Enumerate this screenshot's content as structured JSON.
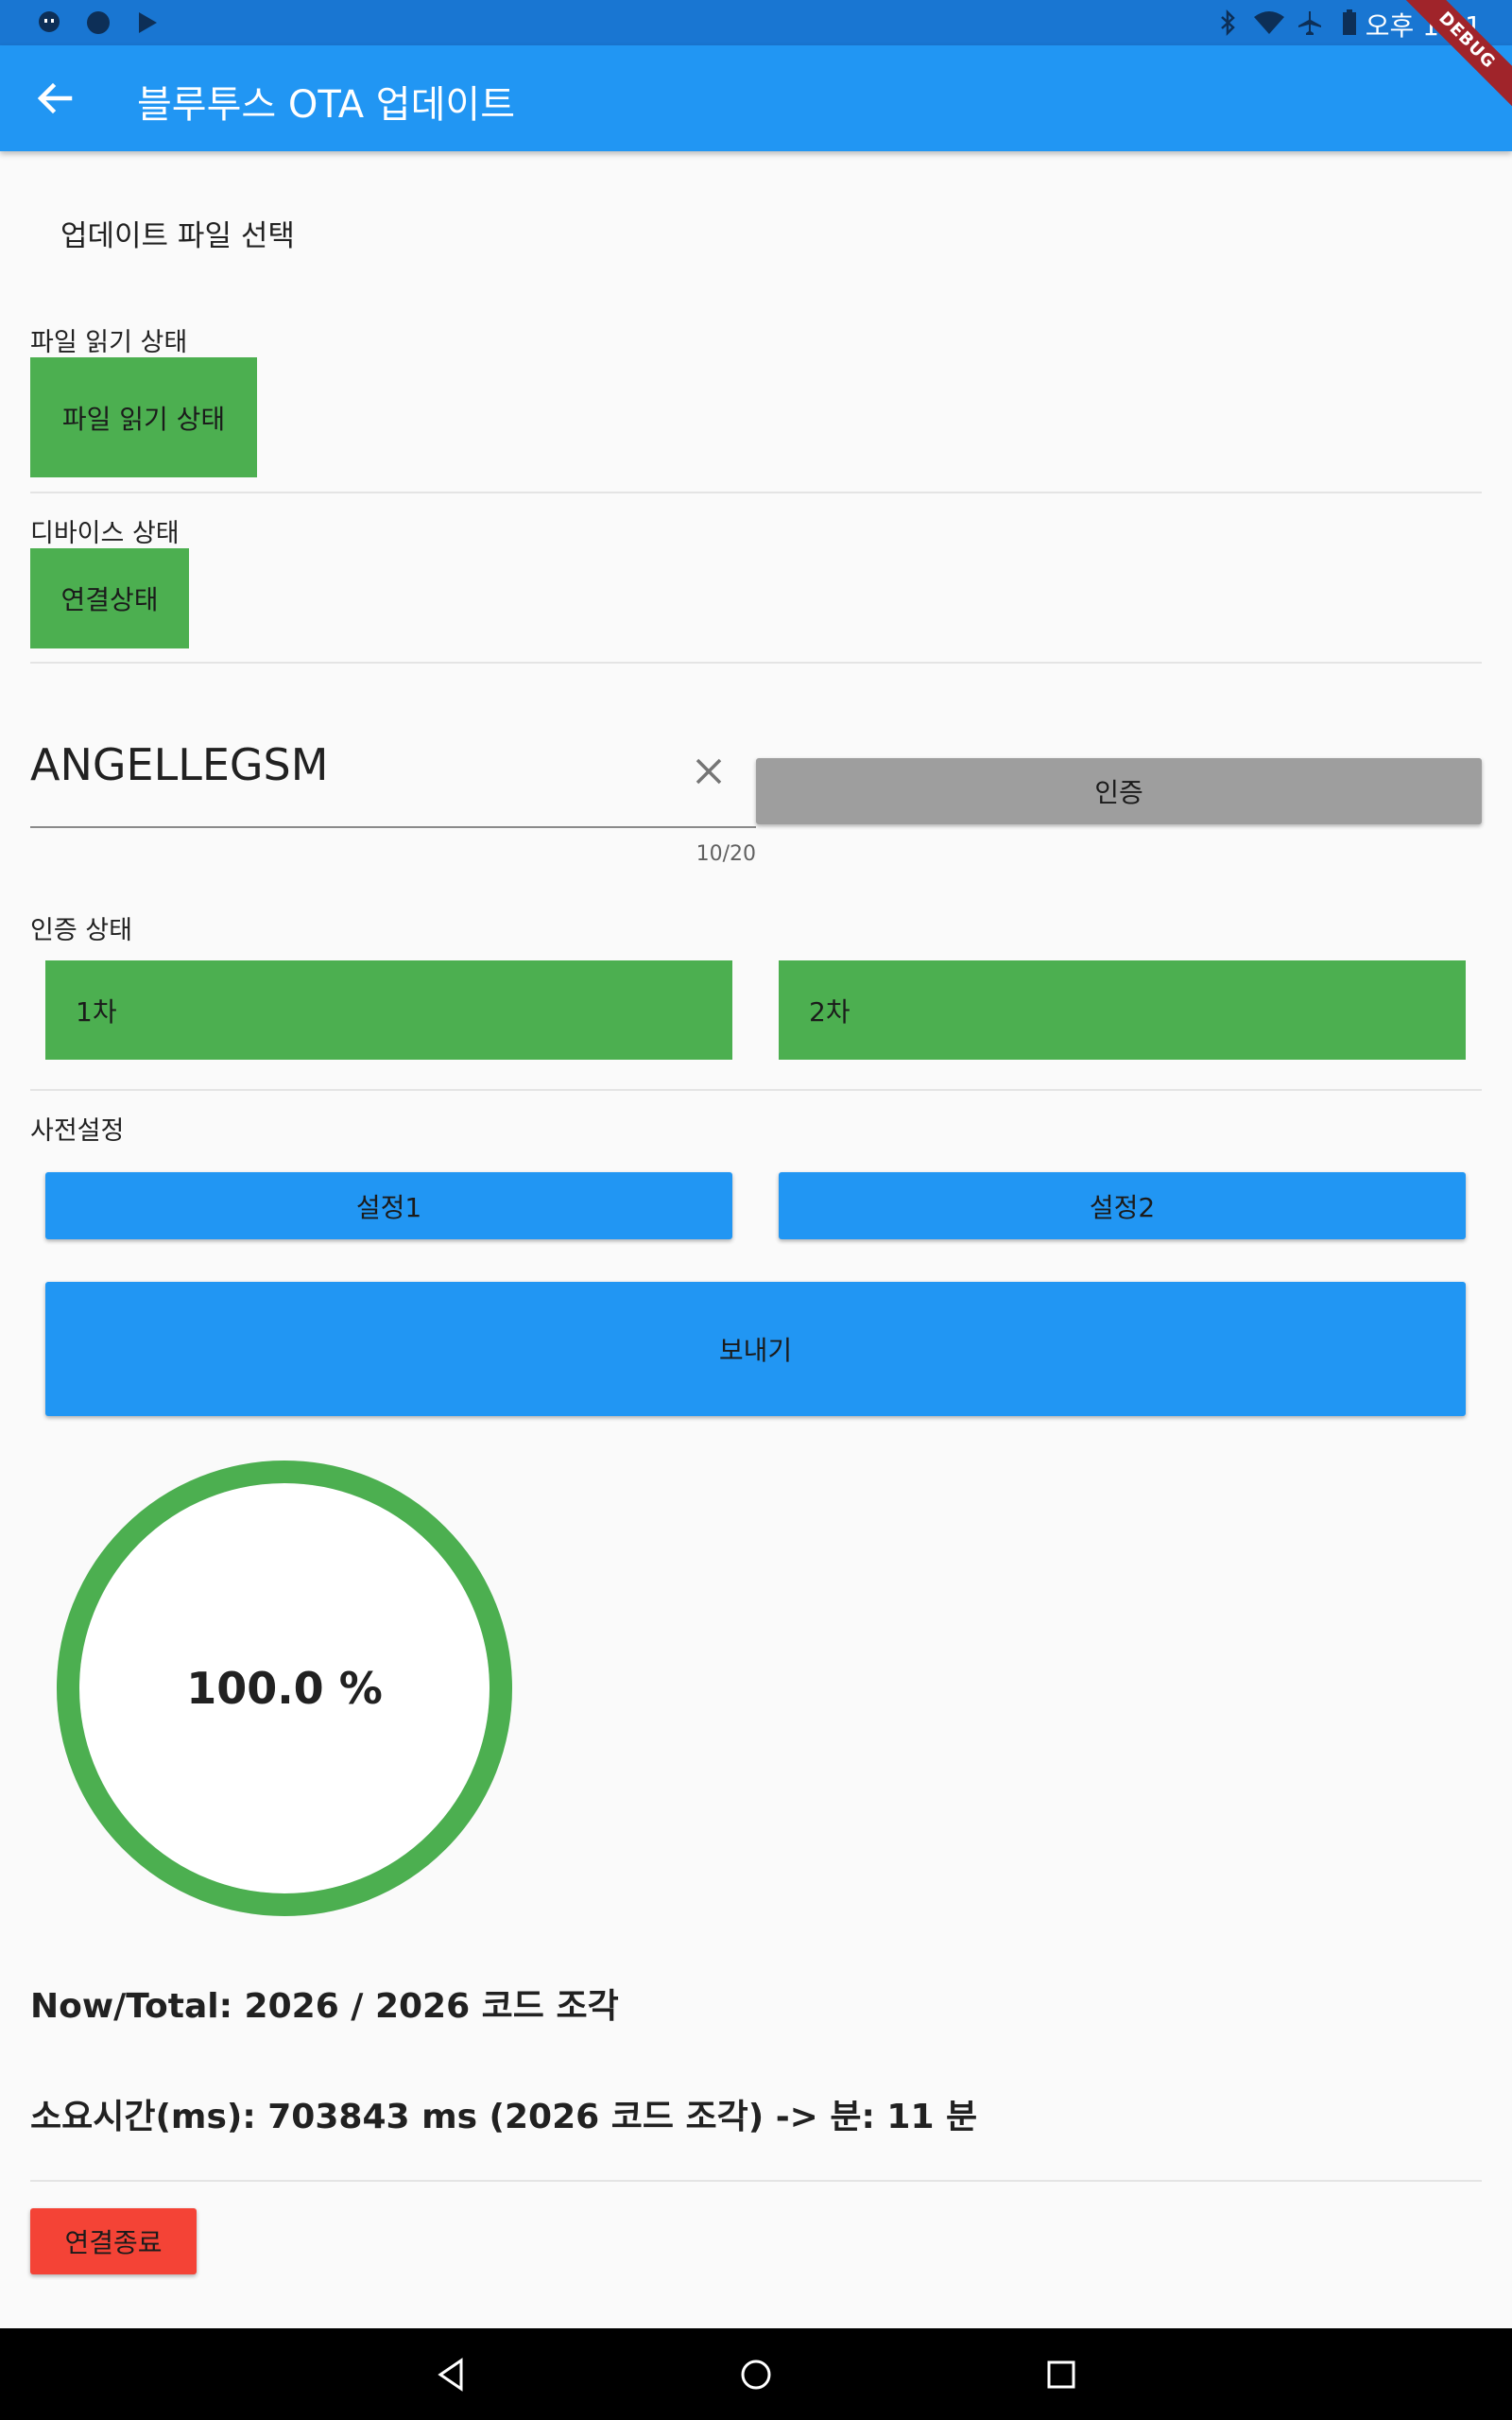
{
  "status_bar": {
    "time": "오후 1:51",
    "left_icons": [
      "chat-icon",
      "circle-app-icon",
      "play-store-icon"
    ],
    "right_icons": [
      "bluetooth-icon",
      "wifi-icon",
      "airplane-icon",
      "battery-icon"
    ]
  },
  "app_bar": {
    "title": "블루투스 OTA 업데이트",
    "back_icon": "arrow-back-icon",
    "debug_label": "DEBUG"
  },
  "file_section": {
    "select_label": "업데이트 파일 선택",
    "read_status_label": "파일 읽기 상태",
    "read_status_value": "파일 읽기 상태"
  },
  "device_section": {
    "label": "디바이스 상태",
    "connection_value": "연결상태"
  },
  "auth_input": {
    "value": "ANGELLEGSM",
    "counter": "10/20",
    "auth_button": "인증"
  },
  "auth_status": {
    "label": "인증 상태",
    "first": "1차",
    "second": "2차"
  },
  "presets": {
    "label": "사전설정",
    "setting1": "설정1",
    "setting2": "설정2",
    "send_button": "보내기"
  },
  "progress": {
    "percent_text": "100.0 %",
    "fraction": 1.0
  },
  "stats": {
    "now_total": "Now/Total: 2026 / 2026 코드 조각",
    "elapsed": "소요시간(ms): 703843 ms (2026 코드 조각) -> 분: 11 분"
  },
  "disconnect_button": "연결종료",
  "colors": {
    "primary": "#2196f3",
    "status_bar": "#1976d2",
    "success": "#4caf50",
    "danger": "#f44336",
    "disabled": "#9e9e9e"
  }
}
